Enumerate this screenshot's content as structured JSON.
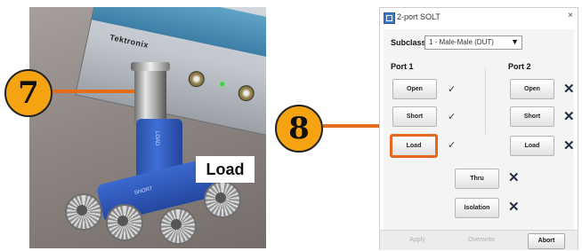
{
  "photo": {
    "tag": "Load",
    "instrument_brand": "Tektronix"
  },
  "callouts": {
    "step7": "7",
    "step8": "8"
  },
  "dialog": {
    "title": "2-port SOLT",
    "close": "×",
    "subclass": {
      "label": "Subclass",
      "value": "1 - Male-Male (DUT)",
      "arrow": "▼"
    },
    "port1": {
      "label": "Port 1",
      "rows": [
        {
          "button": "Open",
          "status": "✓"
        },
        {
          "button": "Short",
          "status": "✓"
        },
        {
          "button": "Load",
          "status": "✓"
        }
      ]
    },
    "port2": {
      "label": "Port 2",
      "rows": [
        {
          "button": "Open",
          "status": "✕"
        },
        {
          "button": "Short",
          "status": "✕"
        },
        {
          "button": "Load",
          "status": "✕"
        }
      ]
    },
    "thru": {
      "button": "Thru",
      "status": "✕"
    },
    "isolation": {
      "button": "Isolation",
      "status": "✕"
    },
    "footer": {
      "apply": "Apply",
      "overwrite": "Overwrite",
      "abort": "Abort"
    }
  },
  "colors": {
    "callout": "#f6a312",
    "leader": "#e46d1b",
    "highlight": "#e8671c"
  }
}
